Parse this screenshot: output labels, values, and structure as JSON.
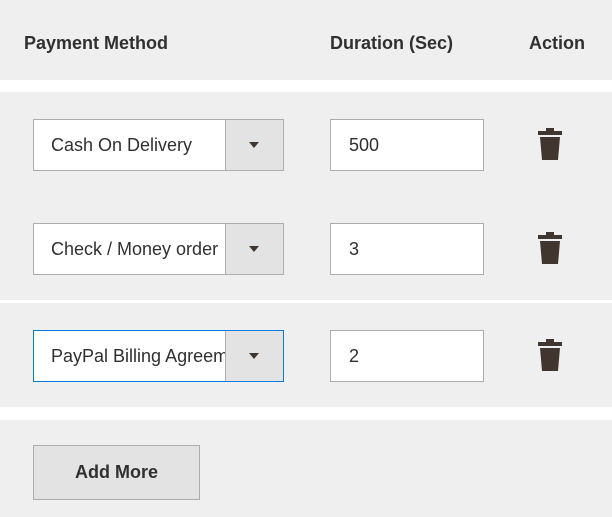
{
  "header": {
    "col_payment": "Payment Method",
    "col_duration": "Duration (Sec)",
    "col_action": "Action"
  },
  "rows": [
    {
      "method": "Cash On Delivery",
      "duration": "500",
      "focused": false
    },
    {
      "method": "Check / Money order",
      "duration": "3",
      "focused": false
    },
    {
      "method": "PayPal Billing Agreement",
      "duration": "2",
      "focused": true
    }
  ],
  "footer": {
    "add_label": "Add More"
  },
  "icons": {
    "select_toggle": "chevron-down-icon",
    "delete": "trash-icon"
  },
  "colors": {
    "panel_bg": "#efefef",
    "text": "#303030",
    "border": "#adadad",
    "focus_border": "#007bdb",
    "button_bg": "#e3e3e3",
    "icon": "#41362f"
  }
}
